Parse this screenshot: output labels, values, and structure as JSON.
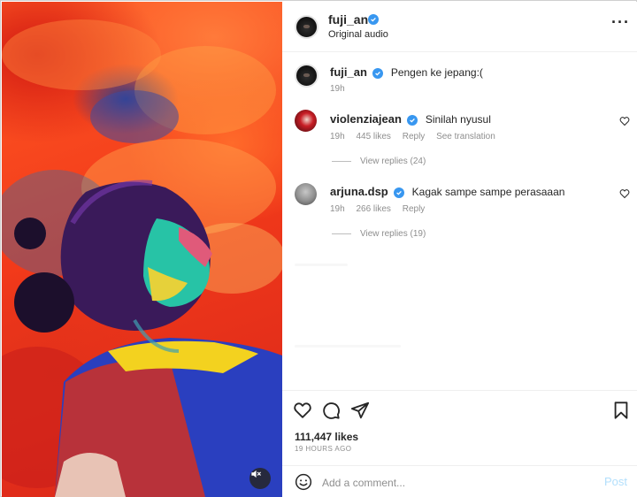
{
  "post": {
    "author": "fuji_an",
    "audio_label": "Original audio",
    "more_icon": "more-horizontal-icon"
  },
  "caption": {
    "author": "fuji_an",
    "text": "Pengen ke jepang:(",
    "time": "19h"
  },
  "comments": [
    {
      "author": "violenziajean",
      "text": "Sinilah nyusul",
      "time": "19h",
      "likes": "445 likes",
      "reply": "Reply",
      "translate": "See translation",
      "view_replies": "View replies (24)"
    },
    {
      "author": "arjuna.dsp",
      "text": "Kagak sampe sampe perasaaan",
      "time": "19h",
      "likes": "266 likes",
      "reply": "Reply",
      "view_replies": "View replies (19)"
    }
  ],
  "actions": {
    "likes": "111,447 likes",
    "timestamp": "19 HOURS AGO"
  },
  "composer": {
    "placeholder": "Add a comment...",
    "post_label": "Post"
  },
  "colors": {
    "verified": "#3897f0",
    "post_disabled": "#b2dffc"
  },
  "icons": [
    "heart-icon",
    "comment-icon",
    "share-icon",
    "bookmark-icon",
    "emoji-icon",
    "mute-icon",
    "verified-badge-icon"
  ]
}
